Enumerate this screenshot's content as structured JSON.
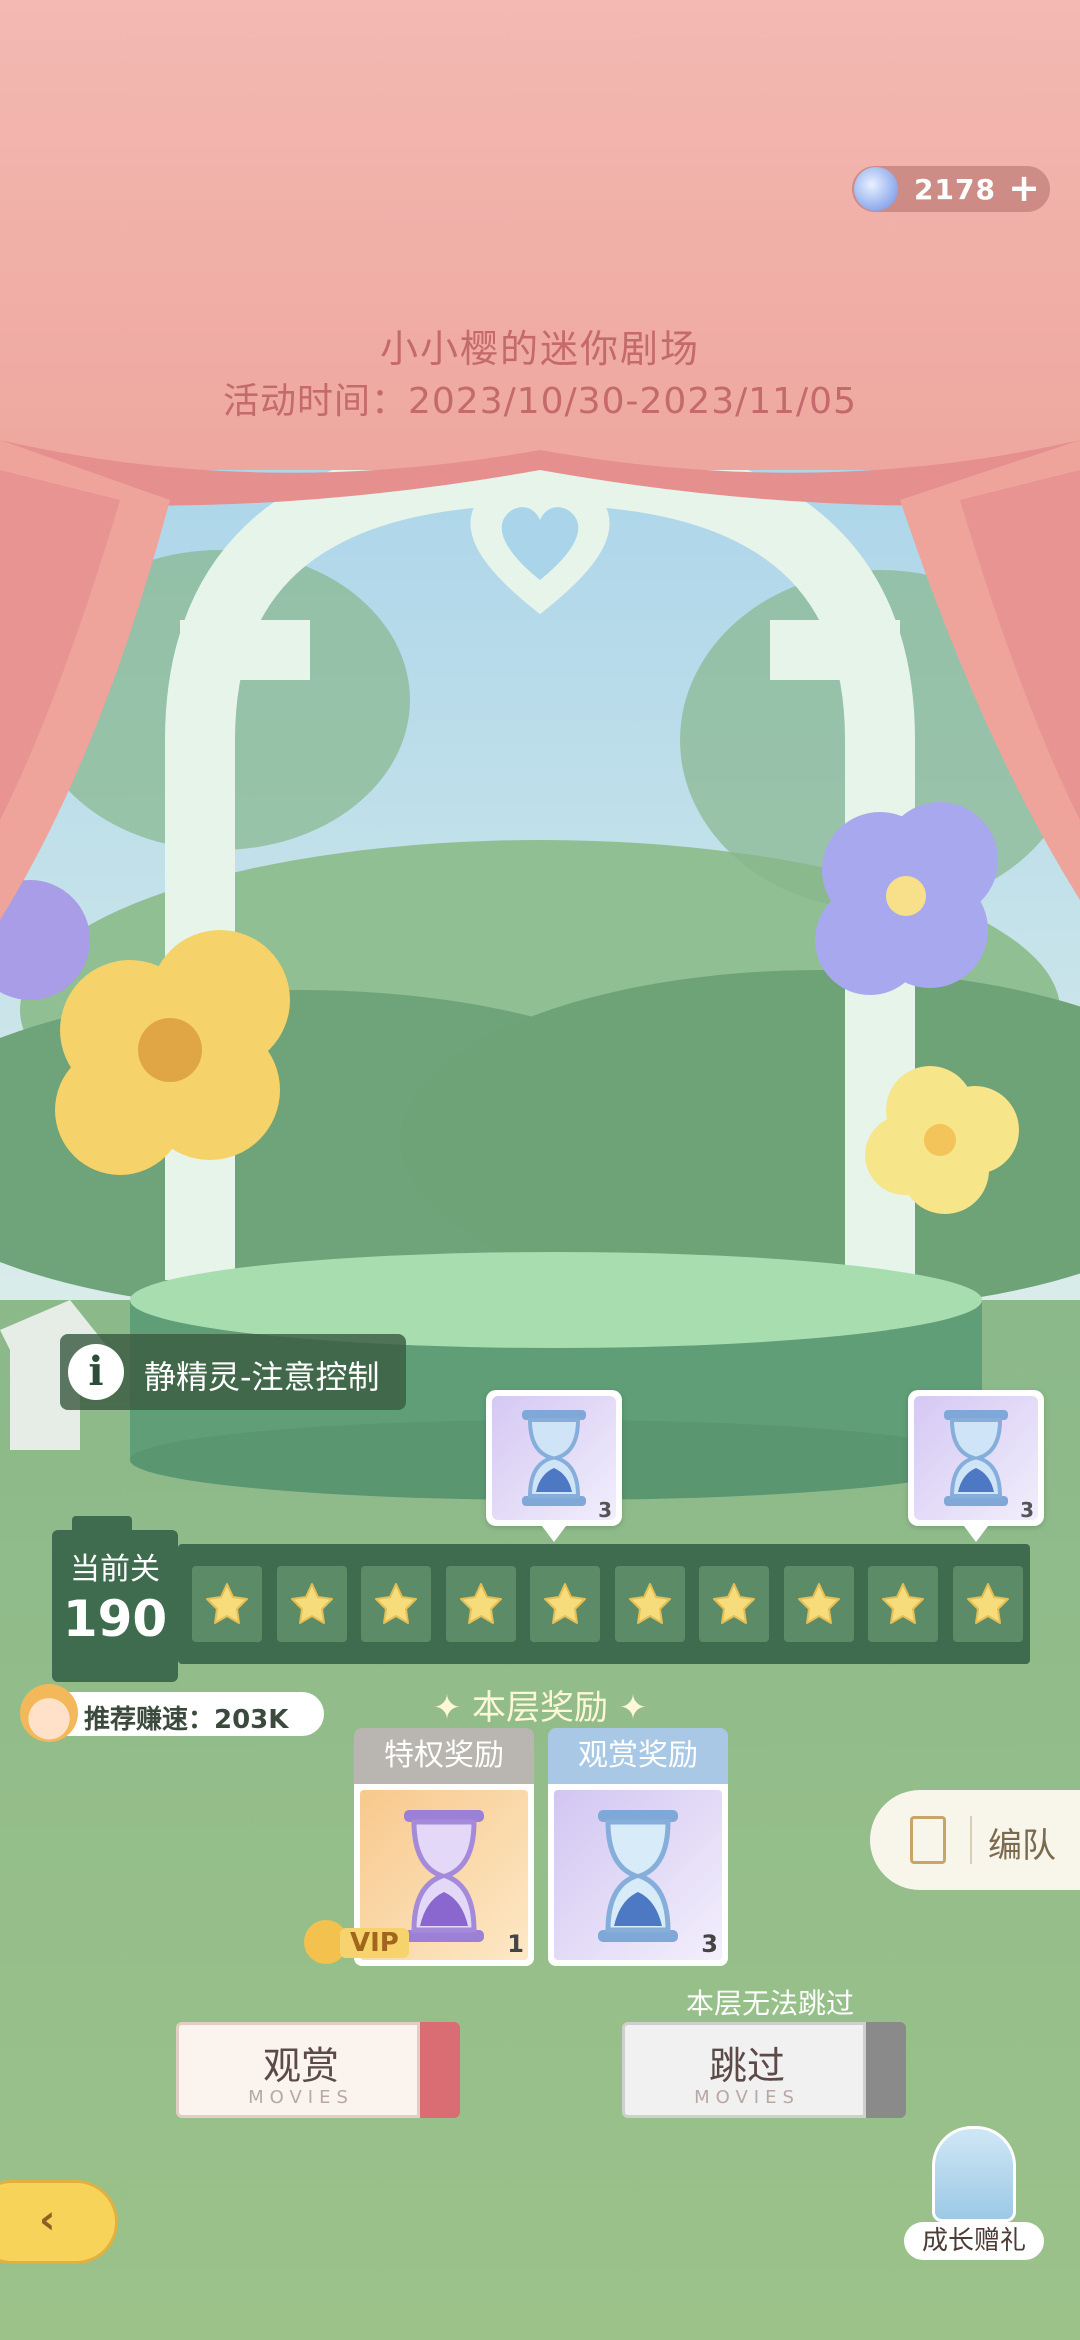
{
  "header": {
    "currency_value": "2178",
    "currency_plus": "+",
    "event_title": "小小樱的迷你剧场",
    "event_time": "活动时间：2023/10/30-2023/11/05"
  },
  "info_tag": {
    "icon_letter": "i",
    "label": "静精灵-注意控制"
  },
  "milestones": [
    {
      "count": "3"
    },
    {
      "count": "3"
    }
  ],
  "level": {
    "label": "当前关",
    "number": "190",
    "stars_filled": 10,
    "stars_total": 10,
    "recommended_speed": "推荐赚速：203K"
  },
  "floor_rewards": {
    "title": "✦ 本层奖励 ✦",
    "privilege": {
      "header": "特权奖励",
      "count": "1",
      "vip_label": "VIP"
    },
    "viewing": {
      "header": "观赏奖励",
      "count": "3"
    }
  },
  "team_button": {
    "label": "编队"
  },
  "actions": {
    "watch": {
      "label": "观赏",
      "sub": "MOVIES"
    },
    "skip": {
      "label": "跳过",
      "sub": "MOVIES",
      "note": "本层无法跳过"
    }
  },
  "gift": {
    "label": "成长赠礼"
  },
  "colors": {
    "curtain": "#eeb0a8",
    "title": "#c46a6c",
    "panel": "#3f6b4f",
    "star": "#f6dc7a",
    "watch_stub": "#d96d73",
    "skip_stub": "#8a8a8a",
    "privilege_header": "#b9b5b0",
    "viewing_header": "#a9c8e6"
  }
}
